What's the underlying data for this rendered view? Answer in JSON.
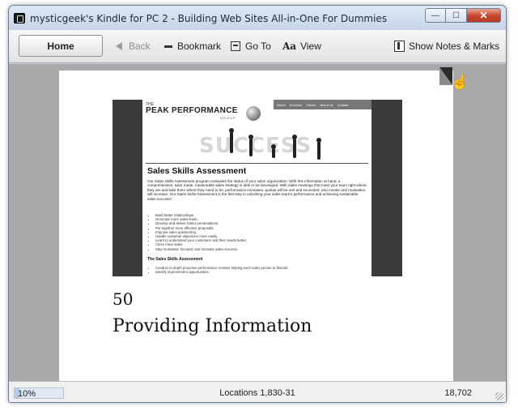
{
  "window": {
    "title": "mysticgeek's Kindle for PC 2 - Building Web Sites All-in-One For Dummies",
    "controls": {
      "minimize": "—",
      "maximize": "☐",
      "close": "✕"
    }
  },
  "toolbar": {
    "home_label": "Home",
    "back_label": "Back",
    "bookmark_label": "Bookmark",
    "goto_label": "Go To",
    "view_icon_text": "Aa",
    "view_label": "View",
    "notes_label": "Show Notes & Marks"
  },
  "page": {
    "figure": {
      "logo_the": "THE",
      "logo_name": "PEAK PERFORMANCE",
      "logo_group": "GROUP",
      "nav": [
        "Home",
        "Services",
        "Clients",
        "About Us",
        "Contact"
      ],
      "banner_text": "SUCCESS",
      "heading": "Sales Skills Assessment",
      "paragraph": "Our Sales Skills Assessment program evaluates the status of your sales organization. With this information at hand, a comprehensive, tailor made, measurable sales strategy is able to be developed. With sales meetings that meet your team right where they are and take them where they need to be, performance increases, quotas will be met and exceeded, and morale and motivation will increase. Our Sales Skills Assessment is the first step in unlocking your sales team's performance and achieving sustainable sales success!",
      "bullets": [
        "Build better relationships.",
        "Generate more sales leads.",
        "Develop and deliver better presentations.",
        "Put together more effective proposals.",
        "Improve sales questioning.",
        "Handle customer objections more easily.",
        "Learn to understand your customers and their needs better.",
        "Close more sales.",
        "Stay motivated, focused, and increase sales success."
      ],
      "subheading": "The Sales Skills Assessment",
      "bullets2": [
        "Conduct in-depth proactive performance reviews helping each sales person to flourish.",
        "Identify improvement opportunities."
      ]
    },
    "page_number": "50",
    "chapter_title": "Providing Information"
  },
  "status": {
    "percent": "10%",
    "progress_fraction": 0.1,
    "locations": "Locations 1,830-31",
    "total": "18,702"
  }
}
